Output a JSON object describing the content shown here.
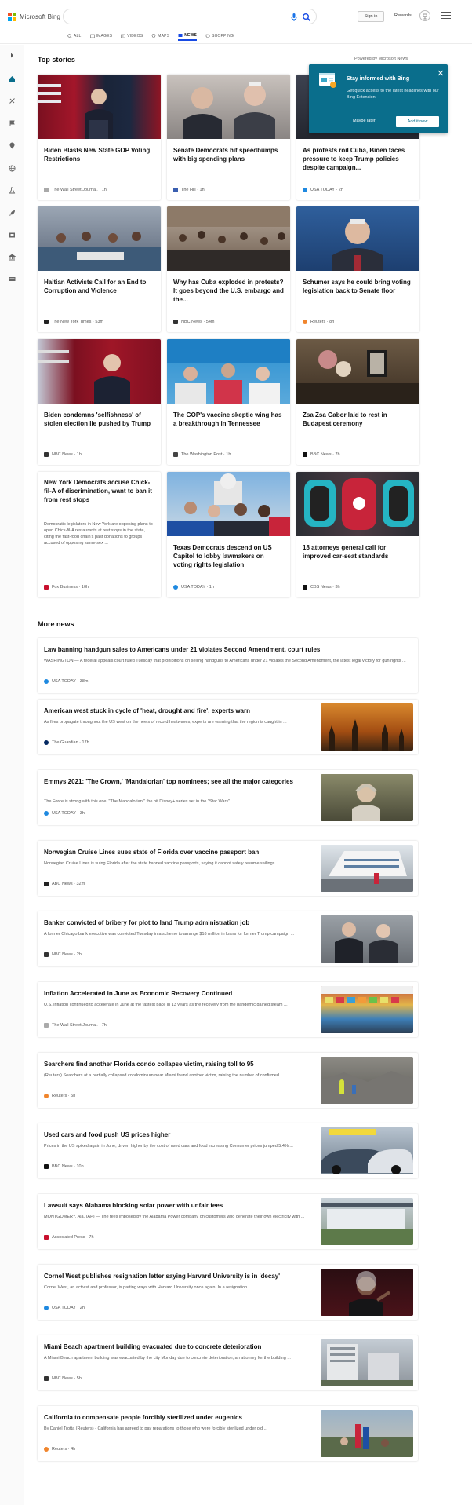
{
  "header": {
    "brand": "Microsoft Bing",
    "sign_in": "Sign in",
    "rewards": "Rewards",
    "search_value": "",
    "tabs": [
      {
        "label": "ALL",
        "icon": "search-icon"
      },
      {
        "label": "IMAGES",
        "icon": "image-icon"
      },
      {
        "label": "VIDEOS",
        "icon": "video-icon"
      },
      {
        "label": "MAPS",
        "icon": "map-pin-icon"
      },
      {
        "label": "NEWS",
        "icon": "news-icon",
        "active": true
      },
      {
        "label": "SHOPPING",
        "icon": "tag-icon"
      }
    ]
  },
  "sidebar": {
    "items": [
      "expand-icon",
      "home-icon",
      "sports-icon",
      "flag-icon",
      "location-icon",
      "world-icon",
      "science-icon",
      "rocket-icon",
      "entertainment-icon",
      "bank-icon",
      "money-icon"
    ]
  },
  "top_stories": {
    "title": "Top stories",
    "powered_by": "Powered by Microsoft News",
    "cards": [
      {
        "title": "Biden Blasts New State GOP Voting Restrictions",
        "source": "The Wall Street Journal.",
        "time": "1h"
      },
      {
        "title": "Senate Democrats hit speedbumps with big spending plans",
        "source": "The Hill",
        "time": "1h"
      },
      {
        "title": "As protests roil Cuba, Biden faces pressure to keep Trump policies despite campaign...",
        "source": "USA TODAY",
        "time": "2h"
      },
      {
        "title": "Haitian Activists Call for an End to Corruption and Violence",
        "source": "The New York Times",
        "time": "53m"
      },
      {
        "title": "Why has Cuba exploded in protests? It goes beyond the U.S. embargo and the...",
        "source": "NBC News",
        "time": "54m"
      },
      {
        "title": "Schumer says he could bring voting legislation back to Senate floor",
        "source": "Reuters",
        "time": "8h"
      },
      {
        "title": "Biden condemns 'selfishness' of stolen election lie pushed by Trump",
        "source": "NBC News",
        "time": "1h"
      },
      {
        "title": "The GOP's vaccine skeptic wing has a breakthrough in Tennessee",
        "source": "The Washington Post",
        "time": "1h"
      },
      {
        "title": "Zsa Zsa Gabor laid to rest in Budapest ceremony",
        "source": "BBC News",
        "time": "7h"
      },
      {
        "title": "New York Democrats accuse Chick-fil-A of discrimination, want to ban it from rest stops",
        "snippet": "Democratic legislators in New York are opposing plans to open Chick-fil-A restaurants at rest stops in the state, citing the fast-food chain's past donations to groups accused of opposing same-sex ...",
        "source": "Fox Business",
        "time": "10h"
      },
      {
        "title": "Texas Democrats descend on US Capitol to lobby lawmakers on voting rights legislation",
        "source": "USA TODAY",
        "time": "1h"
      },
      {
        "title": "18 attorneys general call for improved car-seat standards",
        "source": "CBS News",
        "time": "3h"
      }
    ]
  },
  "popup": {
    "title": "Stay informed with Bing",
    "text": "Get quick access to the latest headlines with our Bing Extension",
    "later": "Maybe later",
    "add": "Add it now"
  },
  "more_news": {
    "title": "More news",
    "items": [
      {
        "title": "Law banning handgun sales to Americans under 21 violates Second Amendment, court rules",
        "snippet": "WASHINGTON — A federal appeals court ruled Tuesday that prohibitions on selling handguns to Americans under 21 violates the Second Amendment, the latest legal victory for gun rights ...",
        "source": "USA TODAY",
        "time": "38m"
      },
      {
        "title": "American west stuck in cycle of 'heat, drought and fire', experts warn",
        "snippet": "As fires propagate throughout the US west on the heels of record heatwaves, experts are warning that the region is caught in ...",
        "source": "The Guardian",
        "time": "17h"
      },
      {
        "title": "Emmys 2021: 'The Crown,' 'Mandalorian' top nominees; see all the major categories",
        "snippet": "The Force is strong with this one. \"The Mandalorian,\" the hit Disney+ series set in the \"Star Wars\" ...",
        "source": "USA TODAY",
        "time": "3h"
      },
      {
        "title": "Norwegian Cruise Lines sues state of Florida over vaccine passport ban",
        "snippet": "Norwegian Cruise Lines is suing Florida after the state banned vaccine passports, saying it cannot safely resume sailings ...",
        "source": "ABC News",
        "time": "32m"
      },
      {
        "title": "Banker convicted of bribery for plot to land Trump administration job",
        "snippet": "A former Chicago bank executive was convicted Tuesday in a scheme to arrange $16 million in loans for former Trump campaign ...",
        "source": "NBC News",
        "time": "2h"
      },
      {
        "title": "Inflation Accelerated in June as Economic Recovery Continued",
        "snippet": "U.S. inflation continued to accelerate in June at the fastest pace in 13 years as the recovery from the pandemic gained steam ...",
        "source": "The Wall Street Journal.",
        "time": "7h"
      },
      {
        "title": "Searchers find another Florida condo collapse victim, raising toll to 95",
        "snippet": "(Reuters) Searchers at a partially collapsed condominium near Miami found another victim, raising the number of confirmed ...",
        "source": "Reuters",
        "time": "5h"
      },
      {
        "title": "Used cars and food push US prices higher",
        "snippet": "Prices in the US spiked again in June, driven higher by the cost of used cars and food increasing Consumer prices jumped 5.4% ...",
        "source": "BBC News",
        "time": "10h"
      },
      {
        "title": "Lawsuit says Alabama blocking solar power with unfair fees",
        "snippet": "MONTGOMERY, Ala. (AP) — The fees imposed by the Alabama Power company on customers who generate their own electricity with ...",
        "source": "Associated Press",
        "time": "7h"
      },
      {
        "title": "Cornel West publishes resignation letter saying Harvard University is in 'decay'",
        "snippet": "Cornel West, an activist and professor, is parting ways with Harvard University once again. In a resignation ...",
        "source": "USA TODAY",
        "time": "2h"
      },
      {
        "title": "Miami Beach apartment building evacuated due to concrete deterioration",
        "snippet": "A Miami Beach apartment building was evacuated by the city Monday due to concrete deterioration, an attorney for the building ...",
        "source": "NBC News",
        "time": "5h"
      },
      {
        "title": "California to compensate people forcibly sterilized under eugenics",
        "snippet": "By Daniel Trotta (Reuters) - California has agreed to pay reparations to those who were forcibly sterilized under old ...",
        "source": "Reuters",
        "time": "4h"
      }
    ]
  },
  "colors": {
    "accent": "#174ae4",
    "popup": "#0a6e8c",
    "sidebar_active": "#0a6e8c"
  }
}
